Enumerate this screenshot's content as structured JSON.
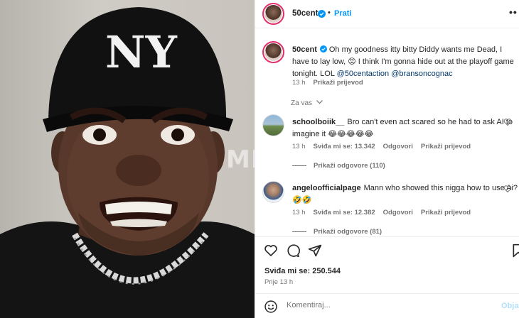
{
  "photo": {
    "cap_logo": "NY",
    "watermark": "MNA"
  },
  "header": {
    "username": "50cent",
    "separator": "•",
    "follow_label": "Prati",
    "more_label": "••"
  },
  "caption": {
    "username": "50cent",
    "text": "Oh my goodness itty bitty Diddy wants me Dead, I have to lay low, 😡 I think I'm gonna hide out at the playoff game tonight. LOL ",
    "mention1": "@50centaction",
    "mention2": "@bransoncognac",
    "time": "13 h",
    "translate": "Prikaži prijevod"
  },
  "section_label": "Za vas",
  "comments": [
    {
      "username": "schoolboiik__",
      "text": "Bro can't even act scared so he had to ask AI to imagine it 😂😂😂😂😂",
      "time": "13 h",
      "likes": "Sviđa mi se: 13.342",
      "reply": "Odgovori",
      "translate": "Prikaži prijevod",
      "replies": "Prikaži odgovore (110)"
    },
    {
      "username": "angeloofficialpage",
      "text": "Mann who showed this nigga how to use Ai? 🤣🤣",
      "time": "13 h",
      "likes": "Sviđa mi se: 12.382",
      "reply": "Odgovori",
      "translate": "Prikaži prijevod",
      "replies": "Prikaži odgovore (81)"
    }
  ],
  "actions": {
    "icons": [
      "heart-icon",
      "comment-icon",
      "share-icon",
      "bookmark-icon"
    ],
    "likes": "Sviđa mi se: 250.544",
    "time": "Prije 13 h"
  },
  "comment_box": {
    "placeholder": "Komentiraj...",
    "post_label": "Objavi"
  },
  "colors": {
    "link": "#00376b",
    "follow": "#0095f6",
    "verified": "#0095f6",
    "muted": "#737373",
    "ring": "#e1306c"
  }
}
